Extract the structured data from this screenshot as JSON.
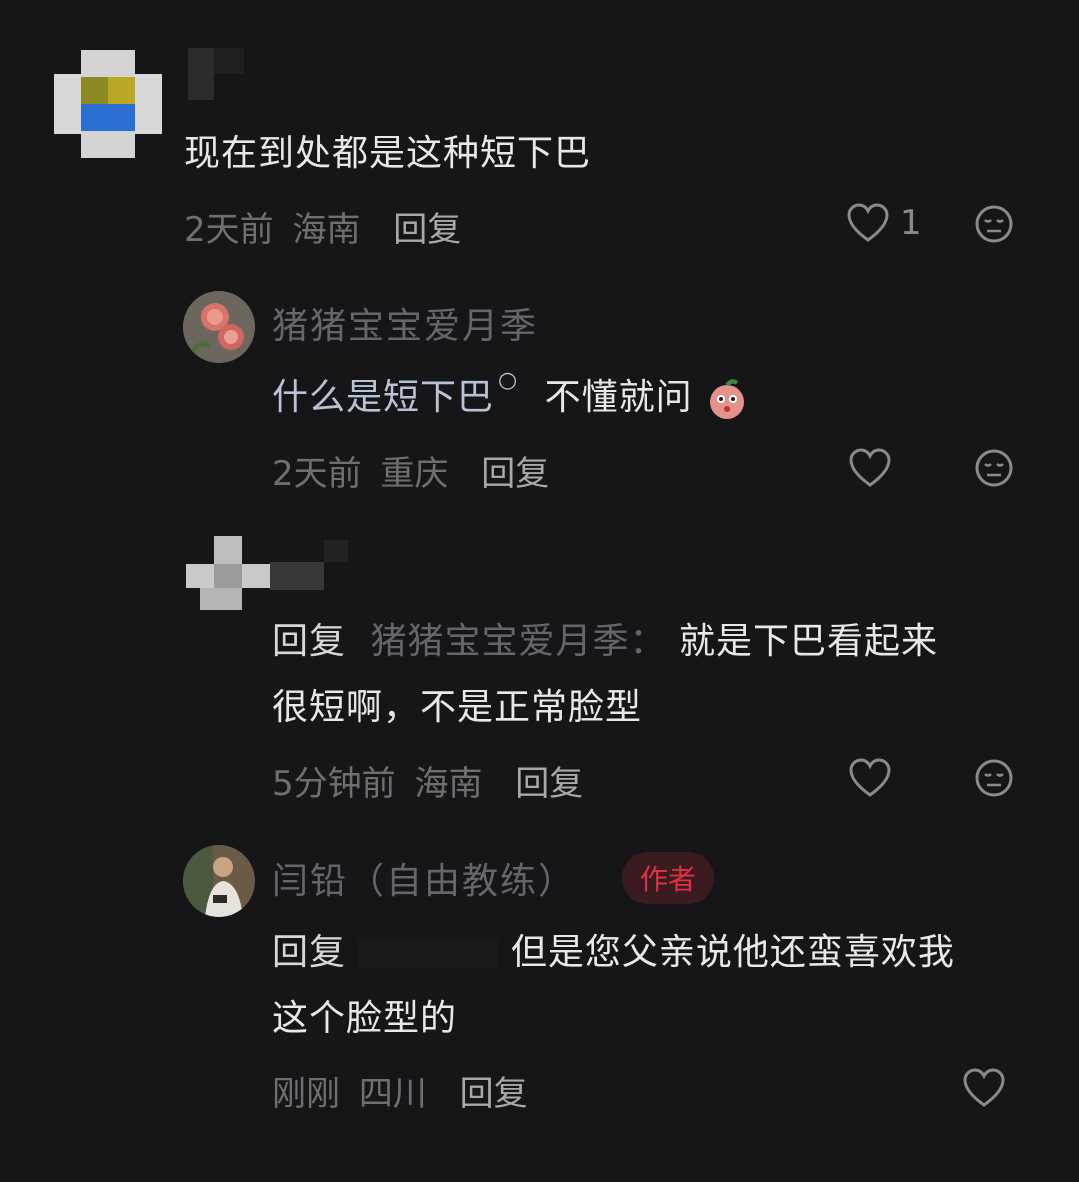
{
  "comments": [
    {
      "text": "现在到处都是这种短下巴",
      "time": "2天前",
      "location": "海南",
      "reply_label": "回复",
      "likes": "1"
    },
    {
      "username": "猪猪宝宝爱月季",
      "text": "什么是短下巴",
      "text_suffix": "不懂就问",
      "time": "2天前",
      "location": "重庆",
      "reply_label": "回复"
    },
    {
      "reply_prefix": "回复",
      "reply_target": "猪猪宝宝爱月季：",
      "text_line1": "就是下巴看起来",
      "text_line2": "很短啊，不是正常脸型",
      "time": "5分钟前",
      "location": "海南",
      "reply_label": "回复"
    },
    {
      "username": "闫铅（自由教练）",
      "badge": "作者",
      "reply_prefix": "回复",
      "text_line1": "但是您父亲说他还蛮喜欢我",
      "text_line2": "这个脸型的",
      "time": "刚刚",
      "location": "四川",
      "reply_label": "回复"
    }
  ],
  "colors": {
    "background": "#161618",
    "author_badge": "#e0323e"
  }
}
